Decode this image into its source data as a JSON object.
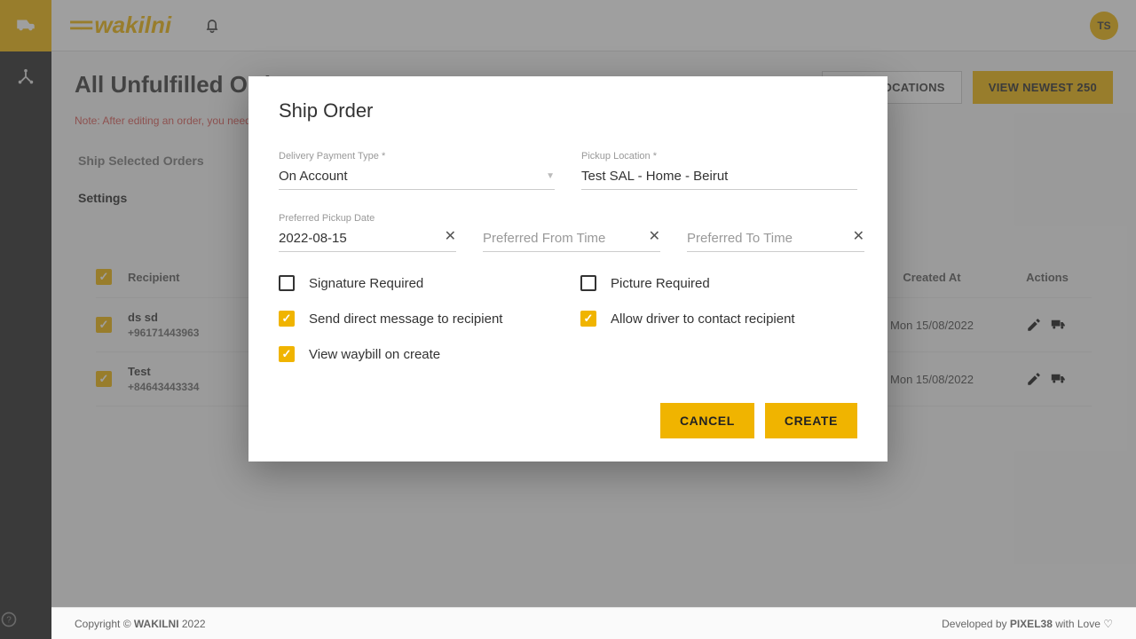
{
  "header": {
    "brand": "wakilni",
    "avatar_initials": "TS"
  },
  "page": {
    "title": "All Unfulfilled Orders",
    "note": "Note: After editing an order, you need to di",
    "sync_btn": "SYNC LOCATIONS",
    "newest_btn": "VIEW NEWEST 250",
    "tab_ship": "Ship Selected Orders",
    "tab_settings": "Settings",
    "th_recipient": "Recipient",
    "th_created": "Created At",
    "th_actions": "Actions"
  },
  "rows": [
    {
      "name": "ds sd",
      "phone": "+96171443963",
      "created": "Mon 15/08/2022"
    },
    {
      "name": "Test",
      "phone": "+84643443334",
      "created": "Mon 15/08/2022"
    }
  ],
  "footer": {
    "left_a": "Copyright © ",
    "left_b": "WAKILNI",
    "left_c": " 2022",
    "right_a": "Developed by ",
    "right_b": "PIXEL38",
    "right_c": " with Love ♡"
  },
  "modal": {
    "title": "Ship Order",
    "delivery_label": "Delivery Payment Type *",
    "delivery_value": "On Account",
    "pickup_label": "Pickup Location *",
    "pickup_value": "Test SAL - Home - Beirut",
    "date_label": "Preferred Pickup Date",
    "date_value": "2022-08-15",
    "from_placeholder": "Preferred From Time",
    "to_placeholder": "Preferred To Time",
    "chk_signature": "Signature Required",
    "chk_picture": "Picture Required",
    "chk_sms": "Send direct message to recipient",
    "chk_driver": "Allow driver to contact recipient",
    "chk_waybill": "View waybill on create",
    "cancel": "CANCEL",
    "create": "CREATE"
  }
}
